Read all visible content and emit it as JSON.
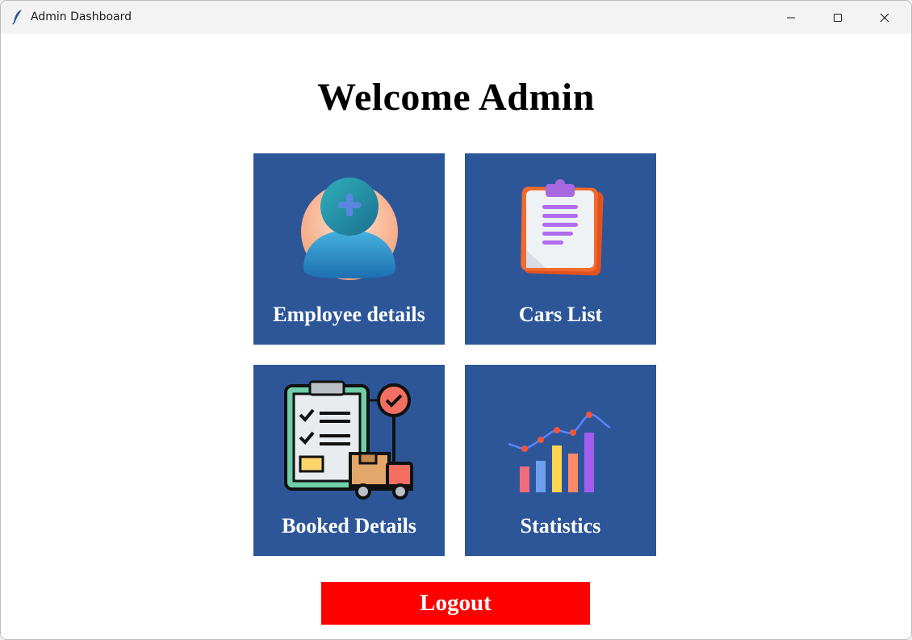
{
  "window": {
    "title": "Admin Dashboard",
    "controls": {
      "minimize_icon": "minimize-icon",
      "maximize_icon": "maximize-icon",
      "close_icon": "close-icon"
    }
  },
  "main": {
    "heading": "Welcome Admin",
    "tiles": [
      {
        "label": "Employee details",
        "icon": "add-user-icon"
      },
      {
        "label": "Cars List",
        "icon": "clipboard-icon"
      },
      {
        "label": "Booked Details",
        "icon": "booking-checklist-icon"
      },
      {
        "label": "Statistics",
        "icon": "bar-chart-icon"
      }
    ],
    "logout_label": "Logout"
  },
  "colors": {
    "tile_bg": "#2d5699",
    "logout_bg": "#ff0000",
    "text_light": "#ffffff"
  }
}
